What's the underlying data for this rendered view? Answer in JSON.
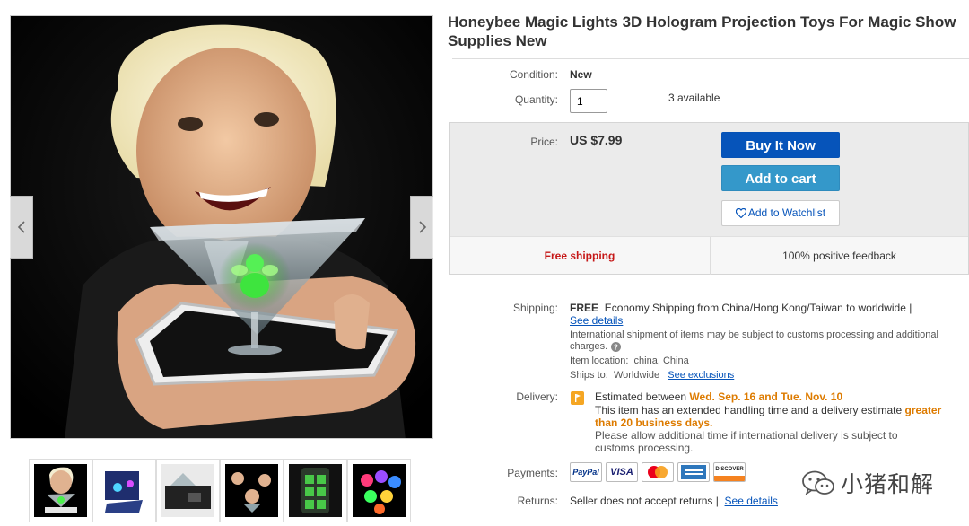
{
  "listing": {
    "title": "Honeybee Magic Lights 3D Hologram Projection Toys For Magic Show Supplies New"
  },
  "details": {
    "condition_label": "Condition:",
    "condition_value": "New",
    "quantity_label": "Quantity:",
    "quantity_value": "1",
    "available": "3 available"
  },
  "buy_box": {
    "price_label": "Price:",
    "price": "US $7.99",
    "buy_now_label": "Buy It Now",
    "add_to_cart_label": "Add to cart",
    "watchlist_label": "Add to Watchlist",
    "free_shipping": "Free shipping",
    "feedback": "100% positive feedback"
  },
  "shipping": {
    "label": "Shipping:",
    "free": "FREE",
    "service": "Economy Shipping from China/Hong Kong/Taiwan to worldwide |",
    "see_details": "See details",
    "intl_note_1": "International shipment of items may be subject to customs processing and additional",
    "intl_note_2": "charges.",
    "location_label": "Item location:",
    "location": "china, China",
    "ships_to_label": "Ships to:",
    "ships_to": "Worldwide",
    "see_exclusions": "See exclusions"
  },
  "delivery": {
    "label": "Delivery:",
    "estimated_prefix": "Estimated between",
    "date_range": "Wed. Sep. 16 and Tue. Nov. 10",
    "handling_prefix": "This item has an extended handling time and a delivery estimate",
    "handling_highlight_1": "greater",
    "handling_highlight_2": "than 20 business days.",
    "allow_note_1": "Please allow additional time if international delivery is subject to",
    "allow_note_2": "customs processing."
  },
  "payments": {
    "label": "Payments:",
    "methods": [
      "paypal-icon",
      "visa-icon",
      "mastercard-icon",
      "amex-icon",
      "discover-icon"
    ],
    "paypal_text": "PayPal",
    "visa_text": "VISA",
    "discover_text": "DISCOVER"
  },
  "returns": {
    "label": "Returns:",
    "text": "Seller does not accept returns |",
    "see_details": "See details"
  },
  "watermark": {
    "text": "小猪和解"
  },
  "colors": {
    "buy_now": "#0654ba",
    "add_to_cart": "#3498ca",
    "free_shipping": "#c61818",
    "highlight": "#dd7b00",
    "link": "#0654ba"
  }
}
